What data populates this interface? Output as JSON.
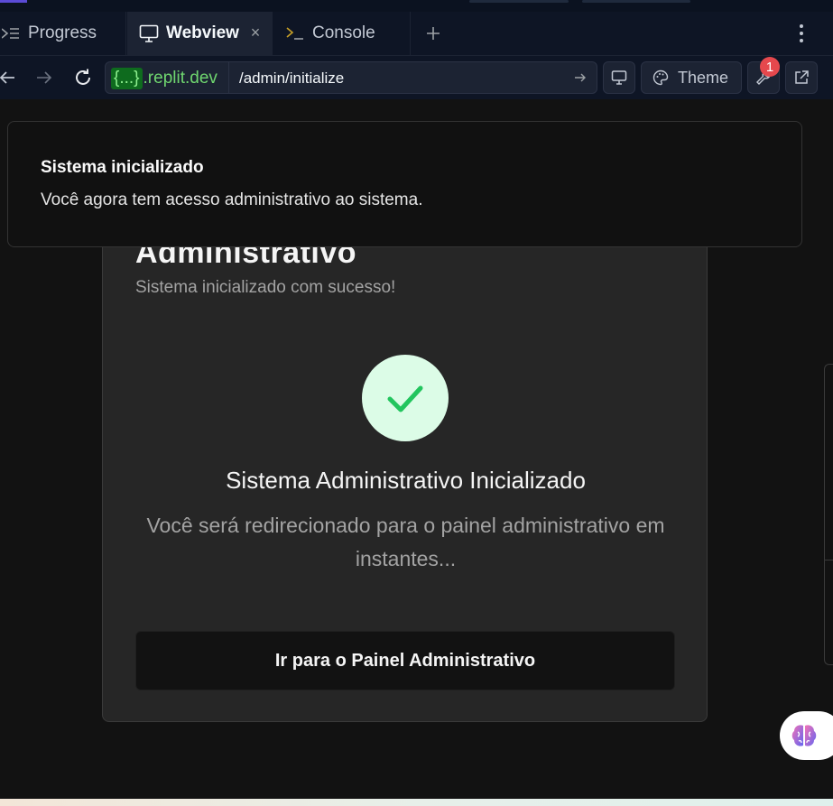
{
  "tabs": [
    {
      "label": "Progress",
      "icon": "progress-icon"
    },
    {
      "label": "Webview",
      "icon": "monitor-icon",
      "active": true
    },
    {
      "label": "Console",
      "icon": "terminal-icon"
    }
  ],
  "address": {
    "dev_badge": "{...}",
    "domain": ".replit.dev",
    "path": "/admin/initialize"
  },
  "toolbar": {
    "theme_label": "Theme",
    "devtools_badge": "1"
  },
  "toast": {
    "title": "Sistema inicializado",
    "description": "Você agora tem acesso administrativo ao sistema."
  },
  "card": {
    "title": "Administrativo",
    "subtitle": "Sistema inicializado com sucesso!",
    "success_title": "Sistema Administrativo Inicializado",
    "success_description": "Você será redirecionado para o painel administrativo em instantes...",
    "button_label": "Ir para o Painel Administrativo"
  },
  "colors": {
    "success": "#22c55e",
    "success_bg": "#dcfce7",
    "badge": "#e5484d",
    "dev_green": "#6fd66f"
  }
}
